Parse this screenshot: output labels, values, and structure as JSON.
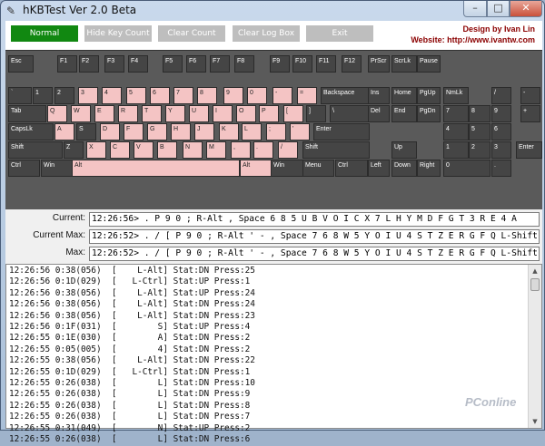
{
  "window": {
    "title": "hKBTest Ver 2.0 Beta",
    "min_glyph": "–",
    "max_glyph": "□",
    "close_glyph": "✕"
  },
  "toolbar": {
    "buttons": [
      "Normal",
      "Hide Key Count",
      "Clear Count",
      "Clear Log Box",
      "Exit"
    ]
  },
  "credit": {
    "line1": "Design by Ivan Lin",
    "line2": "Website: http://www.ivantw.com"
  },
  "keys": {
    "r0": [
      "Esc",
      "F1",
      "F2",
      "F3",
      "F4",
      "F5",
      "F6",
      "F7",
      "F8",
      "F9",
      "F10",
      "F11",
      "F12",
      "PrScr",
      "ScrLk",
      "Pause"
    ],
    "r1": [
      "`",
      "1",
      "2",
      "3",
      "4",
      "5",
      "6",
      "7",
      "8",
      "9",
      "0",
      "-",
      "=",
      "Backspace",
      "Ins",
      "Home",
      "PgUp",
      "NmLk",
      "/",
      "*",
      "-"
    ],
    "r2": [
      "Tab",
      "Q",
      "W",
      "E",
      "R",
      "T",
      "Y",
      "U",
      "I",
      "O",
      "P",
      "[",
      "]",
      "\\",
      "Del",
      "End",
      "PgDn",
      "7",
      "8",
      "9",
      "+"
    ],
    "r3": [
      "CapsLk",
      "A",
      "S",
      "D",
      "F",
      "G",
      "H",
      "J",
      "K",
      "L",
      ";",
      "'",
      "Enter",
      "4",
      "5",
      "6"
    ],
    "r4": [
      "Shift",
      "Z",
      "X",
      "C",
      "V",
      "B",
      "N",
      "M",
      ",",
      ".",
      "/",
      "Shift",
      "Up",
      "1",
      "2",
      "3",
      "Enter"
    ],
    "r5": [
      "Ctrl",
      "Win",
      "Alt",
      "Alt",
      "Win",
      "Menu",
      "Ctrl",
      "Left",
      "Down",
      "Right",
      "0",
      "."
    ]
  },
  "stats": [
    {
      "label": "Current:",
      "value": "12:26:56> . P 9 0 ; R-Alt , Space 6 8 5 U B V O I C X 7 L H Y M D F G T 3 R E 4 A"
    },
    {
      "label": "Current Max:",
      "value": "12:26:52> . / [ P 9 0 ; R-Alt ' - , Space 7 6 8 W 5 Y O I U 4 S T Z E R G F Q L-Shift"
    },
    {
      "label": "Max:",
      "value": "12:26:52> . / [ P 9 0 ; R-Alt ' - , Space 7 6 8 W 5 Y O I U 4 S T Z E R G F Q L-Shift"
    }
  ],
  "log": [
    "12:26:56 0:38(056)  [    L-Alt] Stat:DN Press:25",
    "12:26:56 0:1D(029)  [   L-Ctrl] Stat:UP Press:1",
    "12:26:56 0:38(056)  [    L-Alt] Stat:UP Press:24",
    "12:26:56 0:38(056)  [    L-Alt] Stat:DN Press:24",
    "12:26:56 0:38(056)  [    L-Alt] Stat:DN Press:23",
    "12:26:56 0:1F(031)  [        S] Stat:UP Press:4",
    "12:26:55 0:1E(030)  [        A] Stat:DN Press:2",
    "12:26:55 0:05(005)  [        4] Stat:DN Press:2",
    "12:26:55 0:38(056)  [    L-Alt] Stat:DN Press:22",
    "12:26:55 0:1D(029)  [   L-Ctrl] Stat:DN Press:1",
    "12:26:55 0:26(038)  [        L] Stat:DN Press:10",
    "12:26:55 0:26(038)  [        L] Stat:DN Press:9",
    "12:26:55 0:26(038)  [        L] Stat:DN Press:8",
    "12:26:55 0:26(038)  [        L] Stat:DN Press:7",
    "12:26:55 0:31(049)  [        N] Stat:UP Press:2",
    "12:26:55 0:26(038)  [        L] Stat:DN Press:6"
  ],
  "watermark": "PConline",
  "colors": {
    "normal_button": "#118811",
    "pressed_key": "#f4c4c4",
    "key": "#454545",
    "credit_text": "#8b0000"
  },
  "icons": {
    "app": "keyboard-icon",
    "scroll_up": "triangle-up-icon",
    "scroll_down": "triangle-down-icon"
  }
}
